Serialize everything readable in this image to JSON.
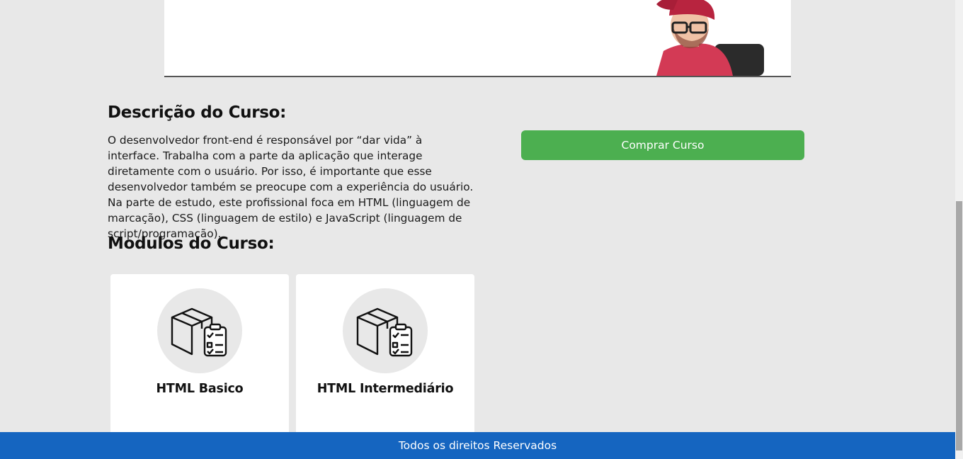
{
  "video": {
    "icon": "person-webcam-thumbnail"
  },
  "description": {
    "title": "Descrição do Curso:",
    "text": "O desenvolvedor front-end é responsável por “dar vida” à interface. Trabalha com a parte da aplicação que interage diretamente com o usuário. Por isso, é importante que esse desenvolvedor também se preocupe com a experiência do usuário. Na parte de estudo, este profissional foca em HTML (linguagem de marcação), CSS (linguagem de estilo) e JavaScript (linguagem de script/programação)."
  },
  "buy_button": {
    "label": "Comprar Curso",
    "color": "#4caf50"
  },
  "modules": {
    "title": "Modulos do Curso:",
    "items": [
      {
        "name": "HTML Basico",
        "icon": "package-checklist-icon"
      },
      {
        "name": "HTML Intermediário",
        "icon": "package-checklist-icon"
      }
    ]
  },
  "footer": {
    "text": "Todos os direitos Reservados",
    "color": "#1565c0"
  }
}
